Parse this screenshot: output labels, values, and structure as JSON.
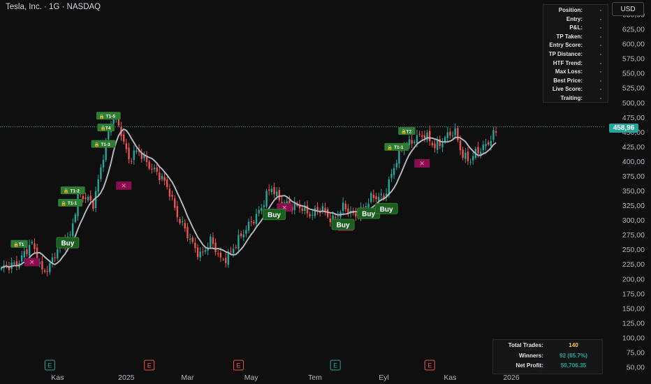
{
  "header": {
    "title": "Tesla, Inc. · 1G · NASDAQ",
    "currency": "USD"
  },
  "last_price": "458,96",
  "stats_panel": [
    {
      "label": "Position:",
      "value": "-"
    },
    {
      "label": "Entry:",
      "value": "-"
    },
    {
      "label": "P&L:",
      "value": "-"
    },
    {
      "label": "TP Taken:",
      "value": "-"
    },
    {
      "label": "Entry Score:",
      "value": "-"
    },
    {
      "label": "TP Distance:",
      "value": "-"
    },
    {
      "label": "HTF Trend:",
      "value": "-"
    },
    {
      "label": "Max Loss:",
      "value": "-"
    },
    {
      "label": "Best Price:",
      "value": "-"
    },
    {
      "label": "Live Score:",
      "value": "-"
    },
    {
      "label": "Traiting:",
      "value": "-"
    }
  ],
  "summary_panel": [
    {
      "label": "Total Trades:",
      "value": "140",
      "color": "#f5c542"
    },
    {
      "label": "Winners:",
      "value": "92 (65.7%)",
      "color": "#26a69a"
    },
    {
      "label": "Net Profit:",
      "value": "50,706.35",
      "color": "#26a69a"
    }
  ],
  "colors": {
    "up": "#26a69a",
    "down": "#ef5350",
    "ma": "#b2b5be",
    "buy_label": "#1b5e20",
    "buy_border": "#2e7d32",
    "exit": "#880e4f",
    "tp": "#2e7d32"
  },
  "chart_data": {
    "type": "candlestick",
    "symbol": "Tesla, Inc.",
    "interval": "1G",
    "exchange": "NASDAQ",
    "y_axis": {
      "ylim": [
        41,
        659
      ],
      "ticks": [
        650,
        625,
        600,
        575,
        550,
        525,
        500,
        475,
        450,
        425,
        400,
        375,
        350,
        325,
        300,
        275,
        250,
        225,
        200,
        175,
        150,
        125,
        100,
        75,
        50
      ],
      "tick_labels": [
        "650,00",
        "625,00",
        "600,00",
        "575,00",
        "550,00",
        "525,00",
        "500,00",
        "475,00",
        "450,00",
        "425,00",
        "400,00",
        "375,00",
        "350,00",
        "325,00",
        "300,00",
        "275,00",
        "250,00",
        "225,00",
        "200,00",
        "175,00",
        "150,00",
        "125,00",
        "100,00",
        "75,00",
        "50,00"
      ]
    },
    "x_axis": {
      "labels": [
        {
          "idx": 22,
          "label": "Kas"
        },
        {
          "idx": 49,
          "label": "2025"
        },
        {
          "idx": 73,
          "label": "Mar"
        },
        {
          "idx": 98,
          "label": "May"
        },
        {
          "idx": 123,
          "label": "Tem"
        },
        {
          "idx": 150,
          "label": "Eyl"
        },
        {
          "idx": 176,
          "label": "Kas"
        },
        {
          "idx": 200,
          "label": "2026"
        }
      ]
    },
    "last_price": 458.96,
    "anchors": [
      [
        0,
        212
      ],
      [
        8,
        238
      ],
      [
        12,
        256
      ],
      [
        16,
        218
      ],
      [
        19,
        222
      ],
      [
        24,
        262
      ],
      [
        27,
        278
      ],
      [
        30,
        338
      ],
      [
        36,
        332
      ],
      [
        40,
        410
      ],
      [
        44,
        478
      ],
      [
        47,
        455
      ],
      [
        50,
        402
      ],
      [
        54,
        415
      ],
      [
        58,
        398
      ],
      [
        62,
        372
      ],
      [
        66,
        350
      ],
      [
        70,
        300
      ],
      [
        74,
        262
      ],
      [
        78,
        245
      ],
      [
        82,
        262
      ],
      [
        86,
        232
      ],
      [
        90,
        248
      ],
      [
        94,
        268
      ],
      [
        98,
        302
      ],
      [
        102,
        320
      ],
      [
        106,
        355
      ],
      [
        110,
        335
      ],
      [
        114,
        318
      ],
      [
        118,
        325
      ],
      [
        122,
        310
      ],
      [
        126,
        316
      ],
      [
        130,
        305
      ],
      [
        134,
        318
      ],
      [
        138,
        310
      ],
      [
        142,
        322
      ],
      [
        146,
        336
      ],
      [
        150,
        345
      ],
      [
        154,
        388
      ],
      [
        158,
        428
      ],
      [
        162,
        442
      ],
      [
        166,
        440
      ],
      [
        170,
        430
      ],
      [
        174,
        438
      ],
      [
        178,
        448
      ],
      [
        181,
        415
      ],
      [
        184,
        402
      ],
      [
        188,
        418
      ],
      [
        192,
        444
      ],
      [
        194,
        452
      ]
    ],
    "moving_average": "smoothed close",
    "earnings_markers": [
      {
        "idx": 19,
        "label": "E",
        "color": "#26a69a"
      },
      {
        "idx": 58,
        "label": "E",
        "color": "#ef5350"
      },
      {
        "idx": 93,
        "label": "E",
        "color": "#ef5350"
      },
      {
        "idx": 131,
        "label": "E",
        "color": "#26a69a"
      },
      {
        "idx": 168,
        "label": "E",
        "color": "#ef5350"
      },
      {
        "idx": 210,
        "label": "E",
        "color": "#e040fb"
      }
    ],
    "buy_signals": [
      {
        "idx": 26,
        "price": 262,
        "label": "Buy"
      },
      {
        "idx": 107,
        "price": 310,
        "label": "Buy"
      },
      {
        "idx": 134,
        "price": 293,
        "label": "Buy"
      },
      {
        "idx": 144,
        "price": 312,
        "label": "Buy"
      },
      {
        "idx": 151,
        "price": 320,
        "label": "Buy"
      }
    ],
    "tp_labels": [
      {
        "idx": 7,
        "price": 260,
        "label": "T1"
      },
      {
        "idx": 27,
        "price": 330,
        "label": "T1-1"
      },
      {
        "idx": 28,
        "price": 351,
        "label": "T1-2"
      },
      {
        "idx": 40,
        "price": 430,
        "label": "T1-3"
      },
      {
        "idx": 41,
        "price": 458,
        "label": "T4"
      },
      {
        "idx": 42,
        "price": 478,
        "label": "T1-5"
      },
      {
        "idx": 155,
        "price": 425,
        "label": "T1-1"
      },
      {
        "idx": 159,
        "price": 452,
        "label": "T2"
      }
    ],
    "exit_markers": [
      {
        "idx": 12,
        "price": 229
      },
      {
        "idx": 48,
        "price": 359
      },
      {
        "idx": 111,
        "price": 322
      },
      {
        "idx": 135,
        "price": 289
      },
      {
        "idx": 165,
        "price": 397
      }
    ]
  }
}
